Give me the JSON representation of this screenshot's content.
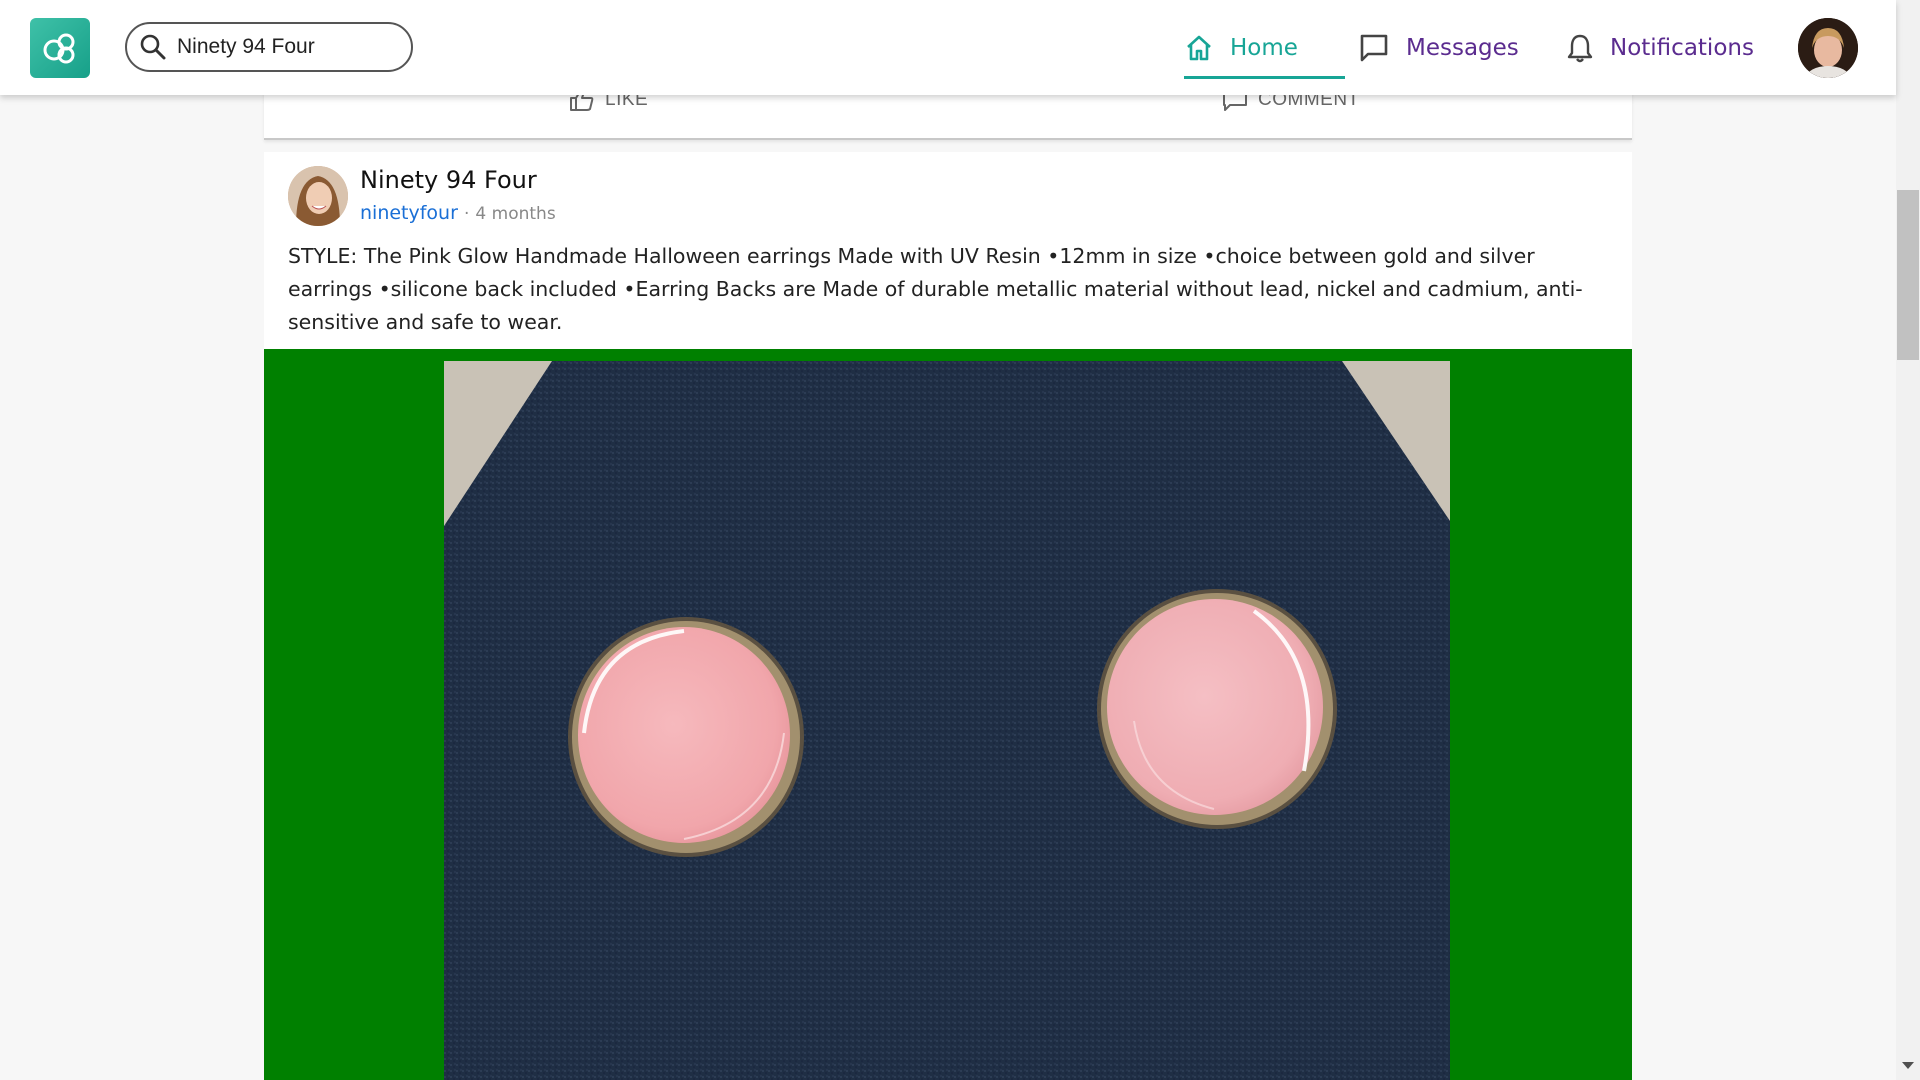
{
  "header": {
    "search_value": "Ninety 94 Four",
    "nav": {
      "home": "Home",
      "messages": "Messages",
      "notifications": "Notifications"
    },
    "accent_color": "#17a596",
    "nav_color": "#5b2c8f"
  },
  "previous_post": {
    "like_label": "LIKE",
    "comment_label": "COMMENT"
  },
  "post": {
    "author": "Ninety 94 Four",
    "handle": "ninetyfour",
    "separator": "·",
    "time": "4 months",
    "text": "STYLE: The Pink Glow Handmade Halloween earrings Made with UV Resin •12mm in size •choice between gold and silver earrings •silicone back included •Earring Backs are Made of durable metallic material without lead, nickel and cadmium, anti-sensitive and safe to wear.",
    "media_background": "#008000"
  },
  "icons": {
    "logo": "app-logo-icon",
    "search": "search-icon",
    "home": "home-icon",
    "messages": "chat-bubble-icon",
    "notifications": "bell-icon",
    "like": "thumbs-up-icon",
    "comment": "comment-icon"
  }
}
